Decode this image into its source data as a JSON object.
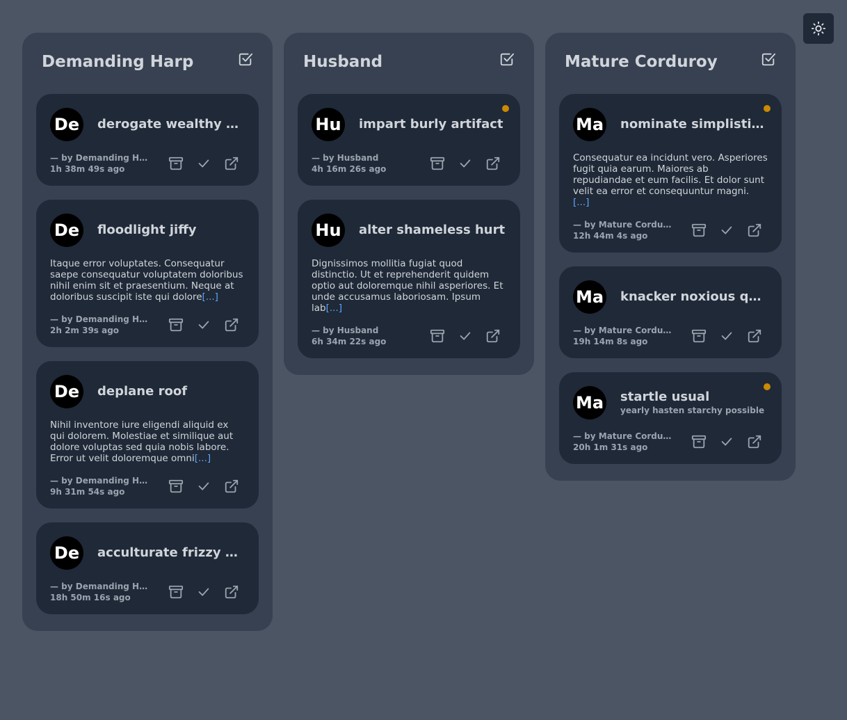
{
  "columns": [
    {
      "title": "Demanding Harp",
      "cards": [
        {
          "initials": "De",
          "title": "derogate wealthy bat…",
          "body": "",
          "more": "",
          "author": "— by Demanding Harp",
          "time": "1h 38m 49s ago",
          "dot": false,
          "subtitle": ""
        },
        {
          "initials": "De",
          "title": "floodlight jiffy",
          "body": "Itaque error voluptates. Consequatur saepe consequatur voluptatem doloribus nihil enim sit et praesentium. Neque at doloribus suscipit iste qui dolore",
          "more": "[...]",
          "author": "— by Demanding Harp",
          "time": "2h 2m 39s ago",
          "dot": false,
          "subtitle": ""
        },
        {
          "initials": "De",
          "title": "deplane roof",
          "body": "Nihil inventore iure eligendi aliquid ex qui dolorem. Molestiae et similique aut dolore voluptas sed quia nobis labore. Error ut velit doloremque omni",
          "more": "[...]",
          "author": "— by Demanding Harp",
          "time": "9h 31m 54s ago",
          "dot": false,
          "subtitle": ""
        },
        {
          "initials": "De",
          "title": "acculturate frizzy acre",
          "body": "",
          "more": "",
          "author": "— by Demanding Harp",
          "time": "18h 50m 16s ago",
          "dot": false,
          "subtitle": ""
        }
      ]
    },
    {
      "title": "Husband",
      "cards": [
        {
          "initials": "Hu",
          "title": "impart burly artifact",
          "body": "",
          "more": "",
          "author": "— by Husband",
          "time": "4h 16m 26s ago",
          "dot": true,
          "subtitle": ""
        },
        {
          "initials": "Hu",
          "title": "alter shameless hurt",
          "body": "Dignissimos mollitia fugiat quod distinctio. Ut et reprehenderit quidem optio aut doloremque nihil asperiores. Et unde accusamus laboriosam. Ipsum lab",
          "more": "[...]",
          "author": "— by Husband",
          "time": "6h 34m 22s ago",
          "dot": false,
          "subtitle": ""
        }
      ]
    },
    {
      "title": "Mature Corduroy",
      "cards": [
        {
          "initials": "Ma",
          "title": "nominate simplistic f…",
          "body": "Consequatur ea incidunt vero. Asperiores fugit quia earum. Maiores ab repudiandae et eum facilis. Et dolor sunt velit ea error et consequuntur magni. ",
          "more": "[...]",
          "author": "— by Mature Cordur…",
          "time": "12h 44m 4s ago",
          "dot": true,
          "subtitle": ""
        },
        {
          "initials": "Ma",
          "title": "knacker noxious quan…",
          "body": "",
          "more": "",
          "author": "— by Mature Cordur…",
          "time": "19h 14m 8s ago",
          "dot": false,
          "subtitle": ""
        },
        {
          "initials": "Ma",
          "title": "startle usual",
          "body": "",
          "more": "",
          "author": "— by Mature Cordur…",
          "time": "20h 1m 31s ago",
          "dot": true,
          "subtitle": "yearly hasten starchy possible"
        }
      ]
    }
  ],
  "icons": {
    "theme": "sun-icon",
    "column_action": "checkbox-check-icon",
    "card_actions": [
      "archive-icon",
      "check-icon",
      "external-link-icon"
    ]
  },
  "colors": {
    "background": "#4b5563",
    "column": "#374151",
    "card": "#1f2937",
    "accent_link": "#60a5fa",
    "unread_dot": "#ca8a04"
  }
}
